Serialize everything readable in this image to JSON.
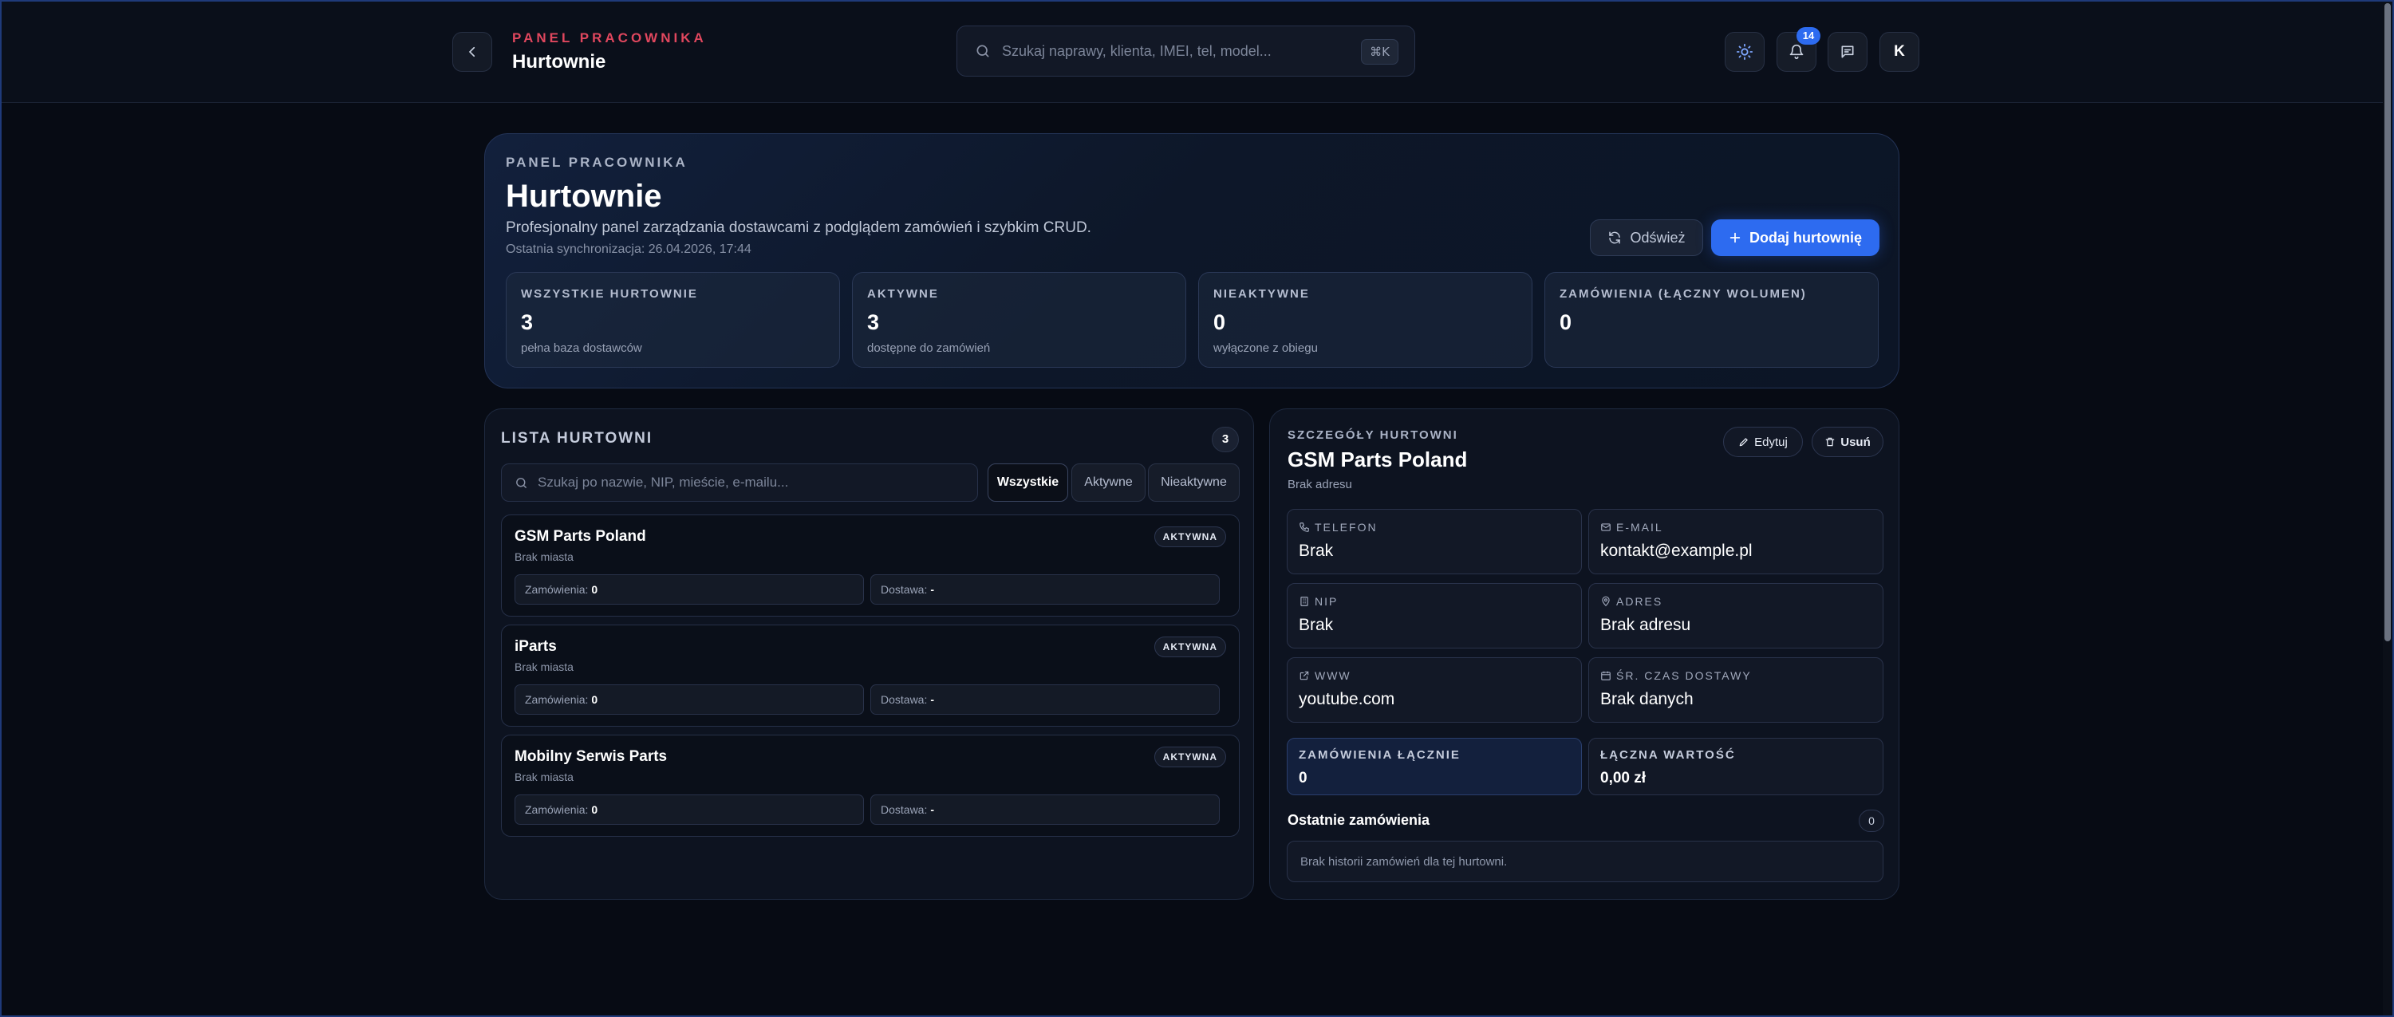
{
  "header": {
    "eyebrow": "PANEL PRACOWNIKA",
    "title": "Hurtownie",
    "search_placeholder": "Szukaj naprawy, klienta, IMEI, tel, model...",
    "shortcut": "⌘K",
    "notification_count": "14",
    "avatar_initial": "K"
  },
  "hero": {
    "eyebrow": "PANEL PRACOWNIKA",
    "title": "Hurtownie",
    "description": "Profesjonalny panel zarządzania dostawcami z podglądem zamówień i szybkim CRUD.",
    "sync": "Ostatnia synchronizacja: 26.04.2026, 17:44",
    "refresh_label": "Odśwież",
    "add_label": "Dodaj hurtownię",
    "stats": [
      {
        "label": "WSZYSTKIE HURTOWNIE",
        "value": "3",
        "sub": "pełna baza dostawców"
      },
      {
        "label": "AKTYWNE",
        "value": "3",
        "sub": "dostępne do zamówień"
      },
      {
        "label": "NIEAKTYWNE",
        "value": "0",
        "sub": "wyłączone z obiegu"
      },
      {
        "label": "ZAMÓWIENIA (ŁĄCZNY WOLUMEN)",
        "value": "0",
        "sub": ""
      }
    ]
  },
  "list": {
    "title": "LISTA HURTOWNI",
    "count": "3",
    "search_placeholder": "Szukaj po nazwie, NIP, mieście, e-mailu...",
    "filters": [
      "Wszystkie",
      "Aktywne",
      "Nieaktywne"
    ],
    "items": [
      {
        "name": "GSM Parts Poland",
        "city": "Brak miasta",
        "status": "AKTYWNA",
        "orders_label": "Zamówienia:",
        "orders": "0",
        "delivery_label": "Dostawa:",
        "delivery": "-"
      },
      {
        "name": "iParts",
        "city": "Brak miasta",
        "status": "AKTYWNA",
        "orders_label": "Zamówienia:",
        "orders": "0",
        "delivery_label": "Dostawa:",
        "delivery": "-"
      },
      {
        "name": "Mobilny Serwis Parts",
        "city": "Brak miasta",
        "status": "AKTYWNA",
        "orders_label": "Zamówienia:",
        "orders": "0",
        "delivery_label": "Dostawa:",
        "delivery": "-"
      }
    ]
  },
  "detail": {
    "eyebrow": "SZCZEGÓŁY HURTOWNI",
    "title": "GSM Parts Poland",
    "address_sub": "Brak adresu",
    "edit_label": "Edytuj",
    "delete_label": "Usuń",
    "fields": {
      "phone": {
        "label": "TELEFON",
        "value": "Brak"
      },
      "email": {
        "label": "E-MAIL",
        "value": "kontakt@example.pl"
      },
      "nip": {
        "label": "NIP",
        "value": "Brak"
      },
      "address": {
        "label": "ADRES",
        "value": "Brak adresu"
      },
      "www": {
        "label": "WWW",
        "value": "youtube.com"
      },
      "delivery_time": {
        "label": "ŚR. CZAS DOSTAWY",
        "value": "Brak danych"
      }
    },
    "orders_total": {
      "label": "ZAMÓWIENIA ŁĄCZNIE",
      "value": "0"
    },
    "total_value": {
      "label": "ŁĄCZNA WARTOŚĆ",
      "value": "0,00 zł"
    },
    "recent_title": "Ostatnie zamówienia",
    "recent_count": "0",
    "recent_empty": "Brak historii zamówień dla tej hurtowni."
  },
  "colors": {
    "background": "#070b14",
    "accent": "#2d6bf0",
    "eyebrow_red": "#e0475e"
  }
}
